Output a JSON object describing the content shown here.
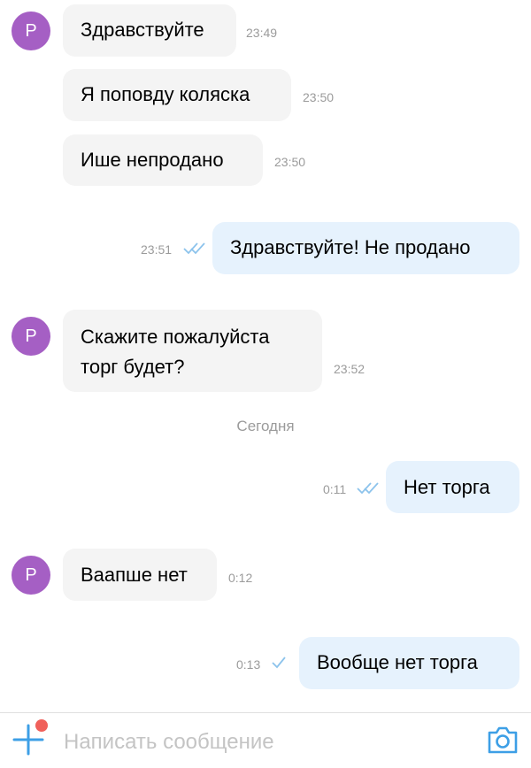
{
  "messages": [
    {
      "avatar": "Р",
      "text": "Здравствуйте",
      "time": "23:49"
    },
    {
      "text": "Я поповду коляска",
      "time": "23:50"
    },
    {
      "text": "Ише непродано",
      "time": "23:50"
    },
    {
      "text": "Здравствуйте! Не продано",
      "time": "23:51"
    },
    {
      "avatar": "Р",
      "text_line1": "Скажите пожалуйста",
      "text_line2": "торг будет?",
      "time": "23:52"
    },
    {
      "text": "Нет торга",
      "time": "0:11"
    },
    {
      "avatar": "Р",
      "text": "Ваапше нет",
      "time": "0:12"
    },
    {
      "text": "Вообще нет торга",
      "time": "0:13"
    }
  ],
  "date_separator": "Сегодня",
  "composer": {
    "placeholder": "Написать сообщение"
  },
  "colors": {
    "avatar": "#a55fc4",
    "outgoing_bubble": "#e6f2fd",
    "incoming_bubble": "#f4f4f4",
    "accent": "#3d9fe6",
    "notification_dot": "#f0605a"
  }
}
